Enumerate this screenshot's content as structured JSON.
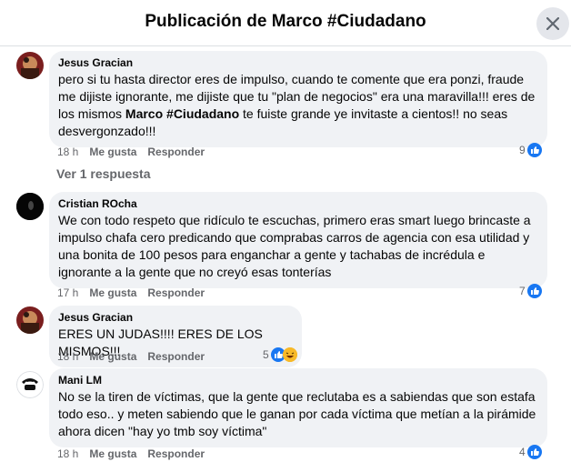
{
  "header": {
    "title": "Publicación de Marco #Ciudadano"
  },
  "comments": [
    {
      "author": "Jesus Gracian",
      "text_parts": [
        "pero si tu hasta director eres de impulso, cuando te comente que era ponzi, fraude me dijiste ignorante, me dijiste que tu \"plan de negocios\" era una maravilla!!! eres de los mismos ",
        "Marco #Ciudadano",
        " te fuiste grande ye invitaste a cientos!! no seas desvergonzado!!!"
      ],
      "time": "18 h",
      "like": "Me gusta",
      "reply": "Responder",
      "reaction_count": "9"
    },
    {
      "author": "Cristian ROcha",
      "text": "We con todo respeto que ridículo te escuchas, primero eras smart luego brincaste a impulso chafa cero predicando que comprabas carros de agencia con esa utilidad y una bonita de 100 pesos para enganchar a gente y tachabas de incrédula e ignorante a la gente que no creyó esas tonterías",
      "time": "17 h",
      "like": "Me gusta",
      "reply": "Responder",
      "reaction_count": "7"
    },
    {
      "author": "Jesus Gracian",
      "text": "ERES UN JUDAS!!!! ERES DE LOS MISMOS!!!",
      "time": "18 h",
      "like": "Me gusta",
      "reply": "Responder",
      "reaction_count": "5"
    },
    {
      "author": "Mani LM",
      "text": "No se la tiren de víctimas, que la gente que reclutaba es a sabiendas que son estafa todo eso.. y meten sabiendo que le ganan por cada víctima que metían a la pirámide ahora dicen \"hay yo tmb soy víctima\"",
      "time": "18 h",
      "like": "Me gusta",
      "reply": "Responder",
      "reaction_count": "4"
    }
  ],
  "view_replies": "Ver 1 respuesta",
  "colors": {
    "like_blue": "#1877f2",
    "bubble": "#f0f2f5",
    "meta": "#65676b"
  },
  "icons": {
    "close": "close-icon",
    "like": "thumbs-up-icon",
    "haha": "haha-emoji-icon"
  }
}
